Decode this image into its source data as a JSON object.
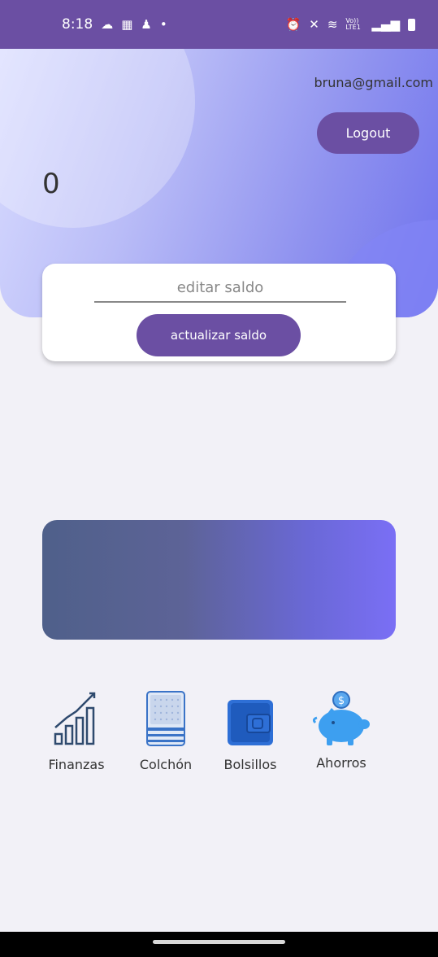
{
  "status_bar": {
    "time": "8:18",
    "left_icons": [
      "cloud-icon",
      "sim-icon",
      "snapchat-icon",
      "dot-icon"
    ],
    "right_icons": [
      "alarm-icon",
      "mute-icon",
      "wifi-icon",
      "volte-icon",
      "signal-icon",
      "battery-icon"
    ],
    "volte_label": "Vo)) LTE1"
  },
  "header": {
    "email": "bruna@gmail.com",
    "logout_label": "Logout",
    "balance": "0"
  },
  "edit_card": {
    "input_placeholder": "editar saldo",
    "input_value": "",
    "update_button_label": "actualizar saldo"
  },
  "categories": [
    {
      "label": "Finanzas",
      "icon": "finance-chart-icon"
    },
    {
      "label": "Colchón",
      "icon": "mattress-icon"
    },
    {
      "label": "Bolsillos",
      "icon": "wallet-icon"
    },
    {
      "label": "Ahorros",
      "icon": "piggy-bank-icon"
    }
  ],
  "colors": {
    "primary": "#6b4fa3",
    "background": "#f2f1f7",
    "header_gradient_start": "#d9dcff",
    "header_gradient_end": "#6f72ee",
    "banner_gradient_start": "#4f608a",
    "banner_gradient_end": "#7a6ff5"
  }
}
